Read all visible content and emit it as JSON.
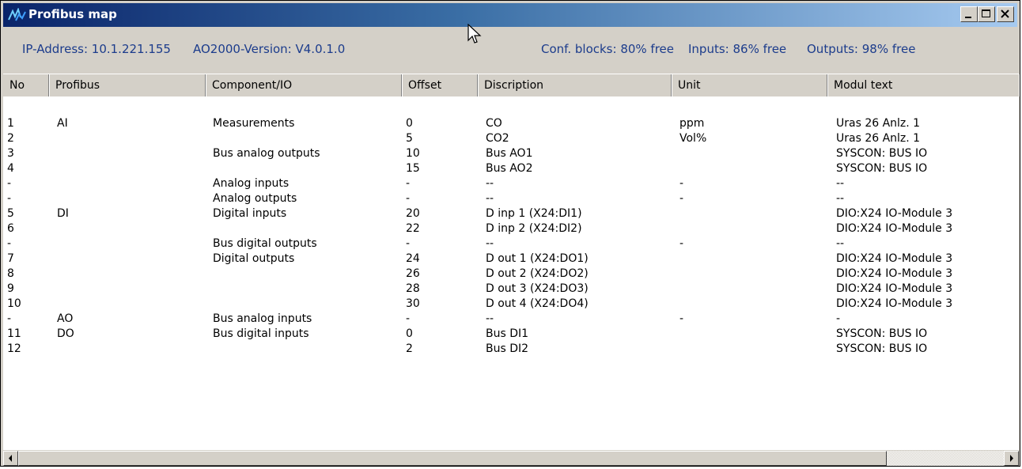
{
  "window": {
    "title": "Profibus map",
    "controls": {
      "minimize": "minimize",
      "maximize": "maximize",
      "close": "close"
    }
  },
  "info": {
    "ip": "IP-Address: 10.1.221.155",
    "version": "AO2000-Version: V4.0.1.0",
    "conf_blocks": "Conf. blocks: 80% free",
    "inputs": "Inputs: 86% free",
    "outputs": "Outputs: 98% free"
  },
  "columns": [
    "No",
    "Profibus",
    "Component/IO",
    "Offset",
    "Discription",
    "Unit",
    "Modul text"
  ],
  "rows": [
    {
      "no": "1",
      "profibus": "AI",
      "component": "Measurements",
      "offset": "0",
      "description": "CO",
      "unit": "ppm",
      "modul": "Uras 26  Anlz. 1"
    },
    {
      "no": "2",
      "profibus": "",
      "component": "",
      "offset": "5",
      "description": "CO2",
      "unit": "Vol%",
      "modul": "Uras 26  Anlz. 1"
    },
    {
      "no": "3",
      "profibus": "",
      "component": "Bus analog outputs",
      "offset": "10",
      "description": "Bus AO1",
      "unit": "",
      "modul": "SYSCON: BUS IO"
    },
    {
      "no": "4",
      "profibus": "",
      "component": "",
      "offset": "15",
      "description": "Bus AO2",
      "unit": "",
      "modul": "SYSCON: BUS IO"
    },
    {
      "no": "-",
      "profibus": "",
      "component": "Analog inputs",
      "offset": "-",
      "description": "--",
      "unit": "-",
      "modul": "--"
    },
    {
      "no": "-",
      "profibus": "",
      "component": "Analog outputs",
      "offset": "-",
      "description": "--",
      "unit": "-",
      "modul": "--"
    },
    {
      "no": "5",
      "profibus": "DI",
      "component": "Digital inputs",
      "offset": "20",
      "description": "D inp 1 (X24:DI1)",
      "unit": "",
      "modul": "DIO:X24  IO-Module 3"
    },
    {
      "no": "6",
      "profibus": "",
      "component": "",
      "offset": "22",
      "description": "D inp 2 (X24:DI2)",
      "unit": "",
      "modul": "DIO:X24  IO-Module 3"
    },
    {
      "no": "-",
      "profibus": "",
      "component": "Bus digital outputs",
      "offset": "-",
      "description": "--",
      "unit": "-",
      "modul": "--"
    },
    {
      "no": "7",
      "profibus": "",
      "component": "Digital outputs",
      "offset": "24",
      "description": "D out 1 (X24:DO1)",
      "unit": "",
      "modul": "DIO:X24  IO-Module 3"
    },
    {
      "no": "8",
      "profibus": "",
      "component": "",
      "offset": "26",
      "description": "D out 2 (X24:DO2)",
      "unit": "",
      "modul": "DIO:X24  IO-Module 3"
    },
    {
      "no": "9",
      "profibus": "",
      "component": "",
      "offset": "28",
      "description": "D out 3 (X24:DO3)",
      "unit": "",
      "modul": "DIO:X24  IO-Module 3"
    },
    {
      "no": "10",
      "profibus": "",
      "component": "",
      "offset": "30",
      "description": "D out 4 (X24:DO4)",
      "unit": "",
      "modul": "DIO:X24  IO-Module 3"
    },
    {
      "no": "-",
      "profibus": "AO",
      "component": "Bus analog inputs",
      "offset": "-",
      "description": "--",
      "unit": "-",
      "modul": "-"
    },
    {
      "no": "11",
      "profibus": "DO",
      "component": "Bus digital inputs",
      "offset": "0",
      "description": "Bus DI1",
      "unit": "",
      "modul": "SYSCON: BUS IO"
    },
    {
      "no": "12",
      "profibus": "",
      "component": "",
      "offset": "2",
      "description": "Bus DI2",
      "unit": "",
      "modul": "SYSCON: BUS IO"
    }
  ],
  "colors": {
    "title_start": "#0a246a",
    "title_end": "#a6caf0",
    "info_text": "#1c3c8c",
    "face": "#d4d0c8"
  }
}
